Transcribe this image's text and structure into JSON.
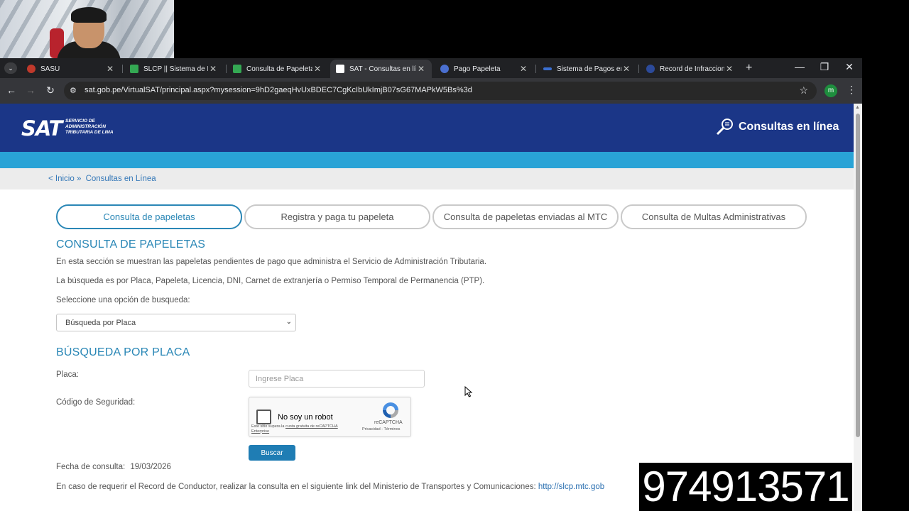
{
  "browser": {
    "tabs": [
      {
        "title": "SASU",
        "favicon_color": "#c0392b",
        "active": false
      },
      {
        "title": "SLCP || Sistema de Lice",
        "favicon_color": "#34a853",
        "active": false
      },
      {
        "title": "Consulta de Papeletas",
        "favicon_color": "#34a853",
        "active": false
      },
      {
        "title": "SAT - Consultas en línea",
        "favicon_color": "#ffffff",
        "active": true
      },
      {
        "title": "Pago Papeleta",
        "favicon_color": "#4a6fd0",
        "active": false
      },
      {
        "title": "Sistema de Pagos en L",
        "favicon_color": "#3b6fd0",
        "active": false
      },
      {
        "title": "Record de Infracciones",
        "favicon_color": "#2c4a9a",
        "active": false
      }
    ],
    "tab_close_glyph": "✕",
    "new_tab_glyph": "+",
    "url": "sat.gob.pe/VirtualSAT/principal.aspx?mysession=9hD2gaeqHvUxBDEC7CgKcIbUkImjB07sG67MAPkW5Bs%3d",
    "profile_initial": "m",
    "icons": [
      "tab-list-icon",
      "back-icon",
      "forward-icon",
      "reload-icon",
      "site-info-icon",
      "bookmark-star-icon",
      "menu-kebab-icon",
      "minimize-icon",
      "restore-icon",
      "close-window-icon"
    ]
  },
  "site": {
    "logo_text": "SAT",
    "logo_subtitle": "Servicio de Administración Tributaria de Lima",
    "header_badge": "Consultas en línea",
    "breadcrumb": {
      "home": "< Inicio »",
      "current": "Consultas en Línea"
    },
    "colors": {
      "header": "#1b3687",
      "band": "#29a3d6",
      "accent": "#2a87b6",
      "button": "#1f7db4"
    }
  },
  "tabs": [
    {
      "label": "Consulta de papeletas",
      "active": true
    },
    {
      "label": "Registra y paga tu papeleta",
      "active": false
    },
    {
      "label": "Consulta de papeletas enviadas al MTC",
      "active": false
    },
    {
      "label": "Consulta de Multas Administrativas",
      "active": false
    }
  ],
  "main": {
    "title": "CONSULTA DE PAPELETAS",
    "intro1": "En esta sección se muestran las papeletas pendientes de pago que administra el Servicio de Administración Tributaria.",
    "intro2": "La búsqueda es por Placa, Papeleta, Licencia, DNI, Carnet de extranjería o Permiso Temporal de Permanencia (PTP).",
    "select_label": "Seleccione una opción de busqueda:",
    "select_value": "Búsqueda por Placa"
  },
  "form": {
    "title": "BÚSQUEDA POR PLACA",
    "placa_label": "Placa:",
    "placa_placeholder": "Ingrese Placa",
    "placa_value": "",
    "codigo_label": "Código de Seguridad:",
    "captcha": {
      "label": "No soy un robot",
      "fine_print_prefix": "Este sitio supera la ",
      "fine_print_link": "cuota gratuita de reCAPTCHA Enterprise",
      "brand": "reCAPTCHA",
      "terms": "Privacidad - Términos"
    },
    "buscar_label": "Buscar",
    "fecha_label": "Fecha de consulta:",
    "fecha_value": "19/03/2026",
    "record_text": "En caso de requerir el Record de Conductor, realizar la consulta en el siguiente link del Ministerio de Transportes y Comunicaciones:",
    "record_link": "http://slcp.mtc.gob"
  },
  "overlay": {
    "phone": "974913571"
  }
}
